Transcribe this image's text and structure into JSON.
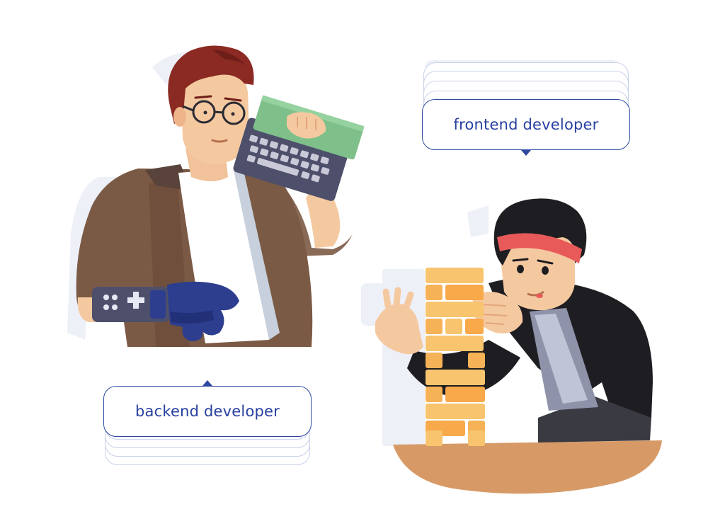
{
  "labels": {
    "frontend": "frontend developer",
    "backend": "backend developer"
  },
  "colors": {
    "label_text": "#2740a0",
    "label_border": "#2e48a0",
    "shadow": "#eef0f8",
    "hair_red": "#8a2a22",
    "jacket_brown": "#7b5a45",
    "keyboard_green": "#7fc08a",
    "glove_blue": "#2d3e8f",
    "jacket_black": "#1e1e22",
    "headband": "#e85a5a",
    "jenga_wood": "#f8c46e",
    "table": "#d79a67"
  },
  "icons": [
    "keyboard-icon",
    "game-controller-icon",
    "jenga-tower-icon"
  ]
}
